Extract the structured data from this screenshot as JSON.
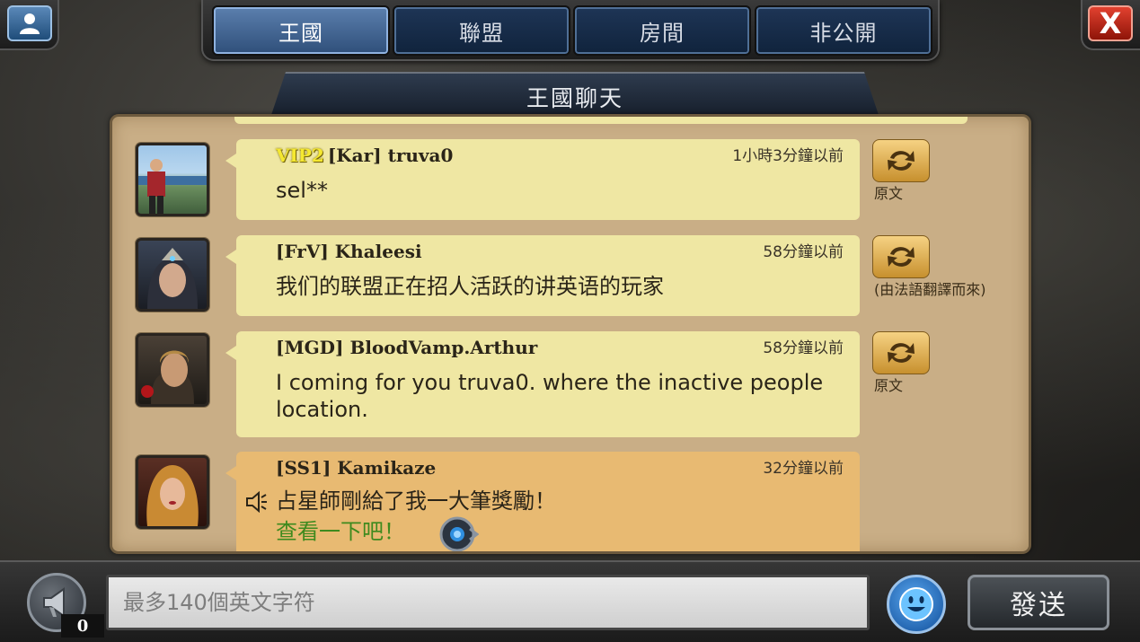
{
  "tabs": [
    {
      "label": "王國",
      "active": true
    },
    {
      "label": "聯盟",
      "active": false
    },
    {
      "label": "房間",
      "active": false
    },
    {
      "label": "非公開",
      "active": false
    }
  ],
  "title": "王國聊天",
  "close_label": "X",
  "messages": [
    {
      "vip": "VIP2",
      "sender": "[Kar] truva0",
      "time": "1小時3分鐘以前",
      "text": "sel**",
      "translate_label": "原文"
    },
    {
      "vip": "",
      "sender": "[FrV] Khaleesi",
      "time": "58分鐘以前",
      "text": "我们的联盟正在招人活跃的讲英语的玩家",
      "translate_label": "(由法語翻譯而來)"
    },
    {
      "vip": "",
      "sender": "[MGD] BloodVamp.Arthur",
      "time": "58分鐘以前",
      "text": "I coming for you truva0. where the inactive people location.",
      "translate_label": "原文"
    },
    {
      "vip": "",
      "sender": "[SS1] Kamikaze",
      "time": "32分鐘以前",
      "text": "占星師剛給了我一大筆獎勵！",
      "link_text": "查看一下吧！"
    }
  ],
  "input": {
    "placeholder": "最多140個英文字符",
    "value": ""
  },
  "speaker_count": "0",
  "send_label": "發送",
  "colors": {
    "tab_active": "#5b7fae",
    "bubble": "#efe7a3",
    "system_bubble": "#e8ba72",
    "panel": "#c9ae86",
    "link_green": "#3e8a1e",
    "vip_yellow": "#f5e830"
  }
}
